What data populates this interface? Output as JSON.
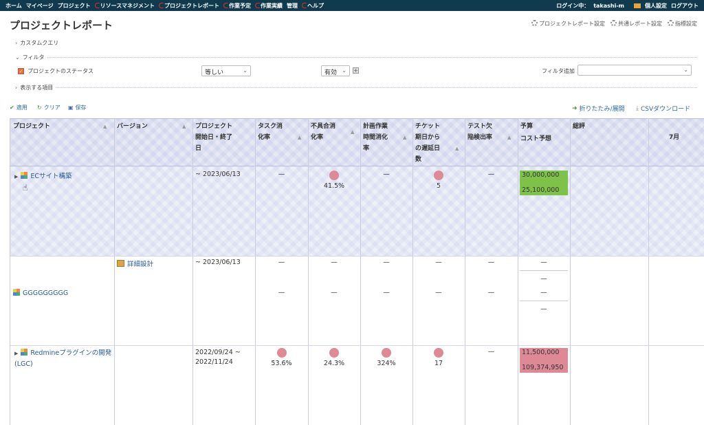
{
  "topbar": {
    "left": [
      "ホーム",
      "マイページ",
      "プロジェクト",
      "リソースマネジメント",
      "プロジェクトレポート",
      "作業予定",
      "作業実績",
      "管理",
      "ヘルプ"
    ],
    "login_label": "ログイン中：",
    "user": "takashi-m",
    "personal": "個人設定",
    "logout": "ログアウト"
  },
  "page": {
    "title": "プロジェクトレポート",
    "settings": [
      "プロジェクトレポート設定",
      "共通レポート設定",
      "指標設定"
    ]
  },
  "query": {
    "custom_query": "カスタムクエリ",
    "filter": "フィルタ",
    "status_label": "プロジェクトのステータス",
    "operator": "等しい",
    "value": "有効",
    "add_filter": "フィルタ追加",
    "display_items": "表示する項目"
  },
  "actions": {
    "apply": "適用",
    "clear": "クリア",
    "save": "保存",
    "collapse": "折りたたみ/展開",
    "csv": "CSVダウンロード"
  },
  "columns": {
    "project": "プロジェクト",
    "version": "バージョン",
    "dates": [
      "プロジェクト",
      "開始日・終了",
      "日"
    ],
    "task": [
      "タスク消",
      "化率"
    ],
    "defect": [
      "不具合消",
      "化率"
    ],
    "planned": [
      "計画作業",
      "時間消化",
      "率"
    ],
    "ticket": [
      "チケット",
      "期日から",
      "の遅延日",
      "数"
    ],
    "test": [
      "テスト欠",
      "陥検出率"
    ],
    "budget": "予算",
    "cost": "コスト予想",
    "review": "総評",
    "month": "7月"
  },
  "rows": [
    {
      "project": "ECサイト構築",
      "dates": "~ 2023/06/13",
      "task": "—",
      "defect": "41.5%",
      "planned": "—",
      "ticket": "5",
      "test": "—",
      "budget": "30,000,000",
      "cost": "25,100,000"
    },
    {
      "project": "GGGGGGGGG",
      "version": "詳細設計",
      "dates": "~ 2023/06/13",
      "task1": "—",
      "task2": "—",
      "defect1": "—",
      "defect2": "—",
      "planned1": "—",
      "planned2": "—",
      "ticket1": "—",
      "ticket2": "—",
      "test1": "—",
      "test2": "—",
      "b1": "—",
      "b2": "—",
      "b3": "—",
      "b4": "—"
    },
    {
      "project": "Redmineプラグインの開発(LGC)",
      "dates1": "2022/09/24 ~",
      "dates2": "2022/11/24",
      "task": "53.6%",
      "defect": "24.3%",
      "planned": "324%",
      "ticket": "17",
      "test": "—",
      "budget": "11,500,000",
      "cost": "109,374,950"
    }
  ]
}
